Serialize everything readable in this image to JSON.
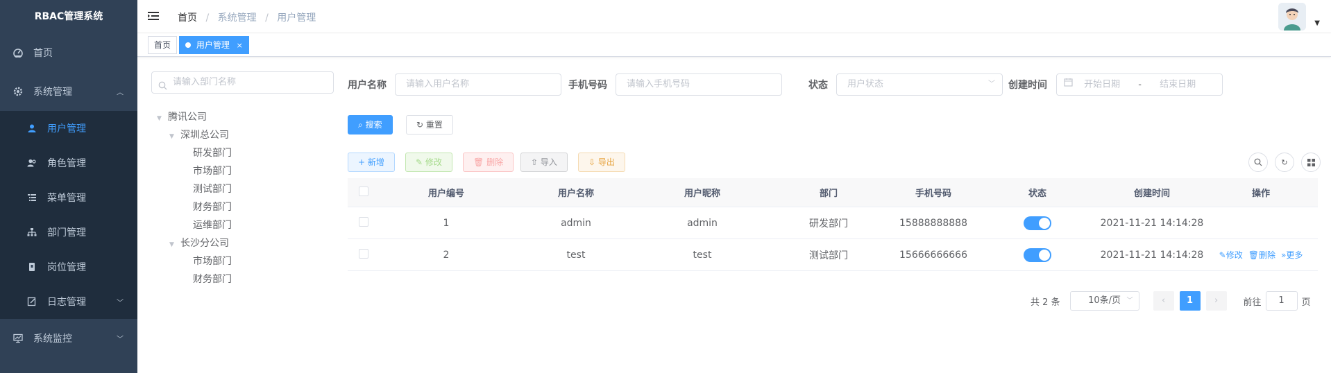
{
  "app": {
    "title": "RBAC管理系统"
  },
  "sidebar": {
    "items": [
      {
        "label": "首页",
        "icon": "dashboard-icon"
      },
      {
        "label": "系统管理",
        "icon": "gear-icon"
      },
      {
        "label": "系统监控",
        "icon": "monitor-icon"
      }
    ],
    "sub_items": [
      {
        "label": "用户管理",
        "icon": "user-icon"
      },
      {
        "label": "角色管理",
        "icon": "users-icon"
      },
      {
        "label": "菜单管理",
        "icon": "menu-list-icon"
      },
      {
        "label": "部门管理",
        "icon": "tree-structure-icon"
      },
      {
        "label": "岗位管理",
        "icon": "badge-icon"
      },
      {
        "label": "日志管理",
        "icon": "edit-icon"
      }
    ]
  },
  "breadcrumb": {
    "home": "首页",
    "level1": "系统管理",
    "level2": "用户管理"
  },
  "tags": {
    "home": "首页",
    "active": "用户管理",
    "close": "×"
  },
  "tree": {
    "placeholder": "请输入部门名称",
    "root": "腾讯公司",
    "branch1": "深圳总公司",
    "branch1_children": [
      "研发部门",
      "市场部门",
      "测试部门",
      "财务部门",
      "运维部门"
    ],
    "branch2": "长沙分公司",
    "branch2_children": [
      "市场部门",
      "财务部门"
    ]
  },
  "search": {
    "username_label": "用户名称",
    "username_placeholder": "请输入用户名称",
    "phone_label": "手机号码",
    "phone_placeholder": "请输入手机号码",
    "status_label": "状态",
    "status_placeholder": "用户状态",
    "date_label": "创建时间",
    "start_placeholder": "开始日期",
    "date_sep": "-",
    "end_placeholder": "结束日期",
    "search_btn": "搜索",
    "reset_btn": "重置"
  },
  "toolbar": {
    "add": "新增",
    "edit": "修改",
    "delete": "删除",
    "import": "导入",
    "export": "导出"
  },
  "table": {
    "columns": [
      "用户编号",
      "用户名称",
      "用户昵称",
      "部门",
      "手机号码",
      "状态",
      "创建时间",
      "操作"
    ],
    "rows": [
      {
        "id": "1",
        "username": "admin",
        "nickname": "admin",
        "dept": "研发部门",
        "phone": "15888888888",
        "status": true,
        "created": "2021-11-21 14:14:28",
        "ops": []
      },
      {
        "id": "2",
        "username": "test",
        "nickname": "test",
        "dept": "测试部门",
        "phone": "15666666666",
        "status": true,
        "created": "2021-11-21 14:14:28",
        "ops": [
          "修改",
          "删除",
          "更多"
        ]
      }
    ]
  },
  "pagination": {
    "total": "共 2 条",
    "page_size": "10条/页",
    "current": "1",
    "goto_prefix": "前往",
    "goto_value": "1",
    "goto_suffix": "页"
  },
  "colors": {
    "primary": "#409eff",
    "sidebar_bg": "#304156",
    "submenu_bg": "#1f2d3d"
  }
}
